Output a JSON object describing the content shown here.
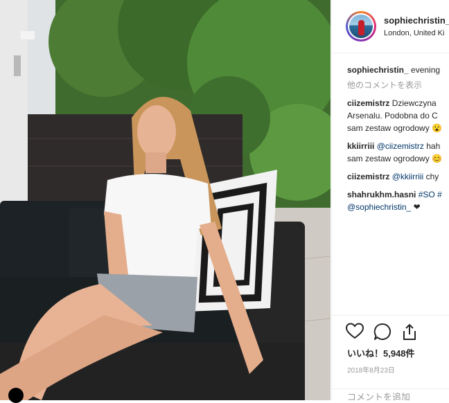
{
  "post": {
    "username": "sophiechristin_",
    "location": "London, United Ki",
    "caption_user": "sophiechristin_",
    "caption_text": "evening",
    "more_comments": "他のコメントを表示",
    "comments": [
      {
        "user": "ciizemistrz",
        "lines": [
          "Dziewczyna",
          "Arsenalu. Podobna do C",
          "sam zestaw ogrodowy 😮"
        ]
      },
      {
        "user": "kkiirriii",
        "mention": "@ciizemistrz",
        "lines": [
          "hah",
          "sam zestaw ogrodowy 😊"
        ]
      },
      {
        "user": "ciizemistrz",
        "mention": "@kkiirriii",
        "lines": [
          "chy"
        ]
      },
      {
        "user": "shahrukhm.hasni",
        "mention": "#SO",
        "rest_text": "#",
        "lines": [
          "@sophiechristin_",
          "❤"
        ]
      }
    ],
    "likes": "いいね！5,948件",
    "date": "2018年8月23日",
    "add_comment_placeholder": "コメントを追加",
    "icons": [
      "heart-icon",
      "comment-icon",
      "share-icon"
    ]
  },
  "colors": {
    "link": "#003569",
    "muted": "#999999",
    "text": "#262626"
  }
}
